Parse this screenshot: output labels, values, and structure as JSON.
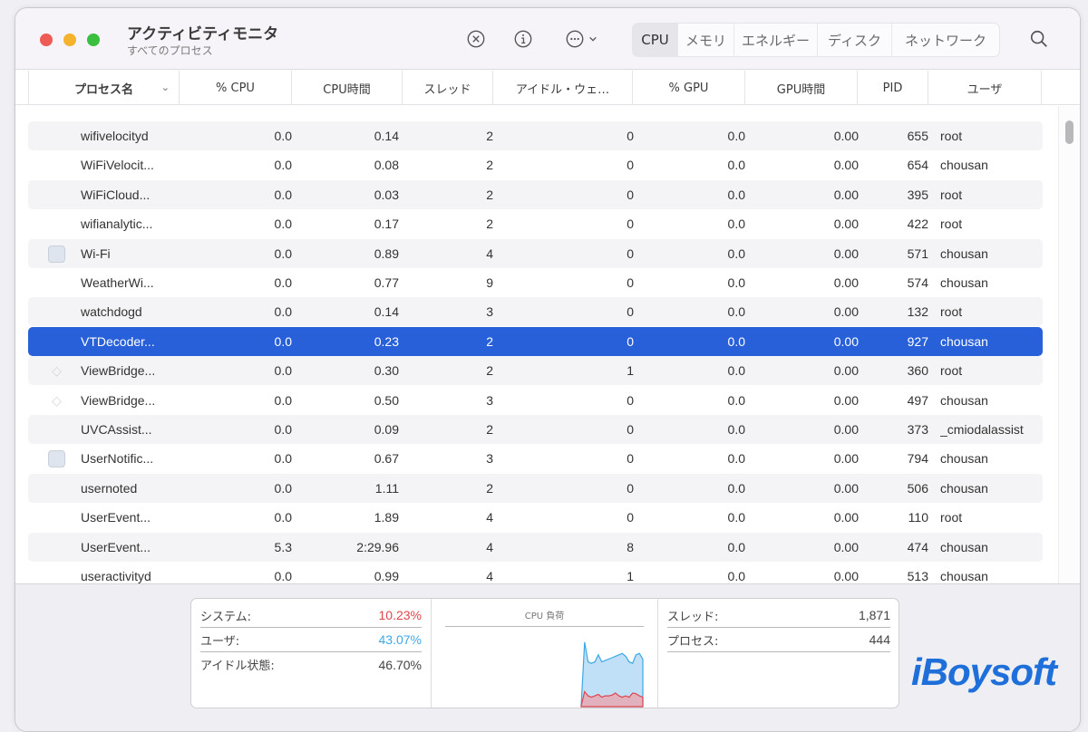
{
  "window": {
    "title": "アクティビティモニタ",
    "subtitle": "すべてのプロセス"
  },
  "toolbar": {
    "stop_icon": "stop-process-icon",
    "info_icon": "info-icon",
    "more_icon": "more-options-icon",
    "search_icon": "search-icon",
    "tabs": [
      {
        "label": "CPU",
        "active": true
      },
      {
        "label": "メモリ",
        "active": false
      },
      {
        "label": "エネルギー",
        "active": false
      },
      {
        "label": "ディスク",
        "active": false
      },
      {
        "label": "ネットワーク",
        "active": false
      }
    ]
  },
  "table": {
    "columns": [
      "プロセス名",
      "% CPU",
      "CPU時間",
      "スレッド",
      "アイドル・ウェ…",
      "% GPU",
      "GPU時間",
      "PID",
      "ユーザ"
    ],
    "rows": [
      {
        "name": "wifivelocityd",
        "cpu": "0.0",
        "cpu_time": "0.14",
        "threads": "2",
        "idle_wake": "0",
        "gpu": "0.0",
        "gpu_time": "0.00",
        "pid": "655",
        "user": "root",
        "icon": ""
      },
      {
        "name": "WiFiVelocit...",
        "cpu": "0.0",
        "cpu_time": "0.08",
        "threads": "2",
        "idle_wake": "0",
        "gpu": "0.0",
        "gpu_time": "0.00",
        "pid": "654",
        "user": "chousan",
        "icon": ""
      },
      {
        "name": "WiFiCloud...",
        "cpu": "0.0",
        "cpu_time": "0.03",
        "threads": "2",
        "idle_wake": "0",
        "gpu": "0.0",
        "gpu_time": "0.00",
        "pid": "395",
        "user": "root",
        "icon": ""
      },
      {
        "name": "wifianalytic...",
        "cpu": "0.0",
        "cpu_time": "0.17",
        "threads": "2",
        "idle_wake": "0",
        "gpu": "0.0",
        "gpu_time": "0.00",
        "pid": "422",
        "user": "root",
        "icon": ""
      },
      {
        "name": "Wi-Fi",
        "cpu": "0.0",
        "cpu_time": "0.89",
        "threads": "4",
        "idle_wake": "0",
        "gpu": "0.0",
        "gpu_time": "0.00",
        "pid": "571",
        "user": "chousan",
        "icon": "app"
      },
      {
        "name": "WeatherWi...",
        "cpu": "0.0",
        "cpu_time": "0.77",
        "threads": "9",
        "idle_wake": "0",
        "gpu": "0.0",
        "gpu_time": "0.00",
        "pid": "574",
        "user": "chousan",
        "icon": ""
      },
      {
        "name": "watchdogd",
        "cpu": "0.0",
        "cpu_time": "0.14",
        "threads": "3",
        "idle_wake": "0",
        "gpu": "0.0",
        "gpu_time": "0.00",
        "pid": "132",
        "user": "root",
        "icon": ""
      },
      {
        "name": "VTDecoder...",
        "cpu": "0.0",
        "cpu_time": "0.23",
        "threads": "2",
        "idle_wake": "0",
        "gpu": "0.0",
        "gpu_time": "0.00",
        "pid": "927",
        "user": "chousan",
        "icon": "",
        "selected": true
      },
      {
        "name": "ViewBridge...",
        "cpu": "0.0",
        "cpu_time": "0.30",
        "threads": "2",
        "idle_wake": "1",
        "gpu": "0.0",
        "gpu_time": "0.00",
        "pid": "360",
        "user": "root",
        "icon": "ghost"
      },
      {
        "name": "ViewBridge...",
        "cpu": "0.0",
        "cpu_time": "0.50",
        "threads": "3",
        "idle_wake": "0",
        "gpu": "0.0",
        "gpu_time": "0.00",
        "pid": "497",
        "user": "chousan",
        "icon": "ghost"
      },
      {
        "name": "UVCAssist...",
        "cpu": "0.0",
        "cpu_time": "0.09",
        "threads": "2",
        "idle_wake": "0",
        "gpu": "0.0",
        "gpu_time": "0.00",
        "pid": "373",
        "user": "_cmiodalassist",
        "icon": ""
      },
      {
        "name": "UserNotific...",
        "cpu": "0.0",
        "cpu_time": "0.67",
        "threads": "3",
        "idle_wake": "0",
        "gpu": "0.0",
        "gpu_time": "0.00",
        "pid": "794",
        "user": "chousan",
        "icon": "app"
      },
      {
        "name": "usernoted",
        "cpu": "0.0",
        "cpu_time": "1.11",
        "threads": "2",
        "idle_wake": "0",
        "gpu": "0.0",
        "gpu_time": "0.00",
        "pid": "506",
        "user": "chousan",
        "icon": ""
      },
      {
        "name": "UserEvent...",
        "cpu": "0.0",
        "cpu_time": "1.89",
        "threads": "4",
        "idle_wake": "0",
        "gpu": "0.0",
        "gpu_time": "0.00",
        "pid": "110",
        "user": "root",
        "icon": ""
      },
      {
        "name": "UserEvent...",
        "cpu": "5.3",
        "cpu_time": "2:29.96",
        "threads": "4",
        "idle_wake": "8",
        "gpu": "0.0",
        "gpu_time": "0.00",
        "pid": "474",
        "user": "chousan",
        "icon": ""
      },
      {
        "name": "useractivityd",
        "cpu": "0.0",
        "cpu_time": "0.99",
        "threads": "4",
        "idle_wake": "1",
        "gpu": "0.0",
        "gpu_time": "0.00",
        "pid": "513",
        "user": "chousan",
        "icon": ""
      }
    ]
  },
  "summary": {
    "system_label": "システム:",
    "system_value": "10.23%",
    "user_label": "ユーザ:",
    "user_value": "43.07%",
    "idle_label": "アイドル状態:",
    "idle_value": "46.70%",
    "chart_title": "CPU 負荷",
    "threads_label": "スレッド:",
    "threads_value": "1,871",
    "processes_label": "プロセス:",
    "processes_value": "444",
    "colors": {
      "system": "#e0454c",
      "user": "#3da8e6"
    },
    "cpu_load_user_pct": [
      0,
      90,
      62,
      60,
      62,
      72,
      62,
      64,
      66,
      68,
      70,
      72,
      74,
      70,
      62,
      60,
      72,
      74,
      66
    ],
    "cpu_load_system_pct": [
      0,
      20,
      14,
      12,
      14,
      16,
      12,
      14,
      14,
      15,
      18,
      14,
      12,
      14,
      12,
      18,
      17,
      14,
      12
    ]
  },
  "watermark": "iBoysoft"
}
